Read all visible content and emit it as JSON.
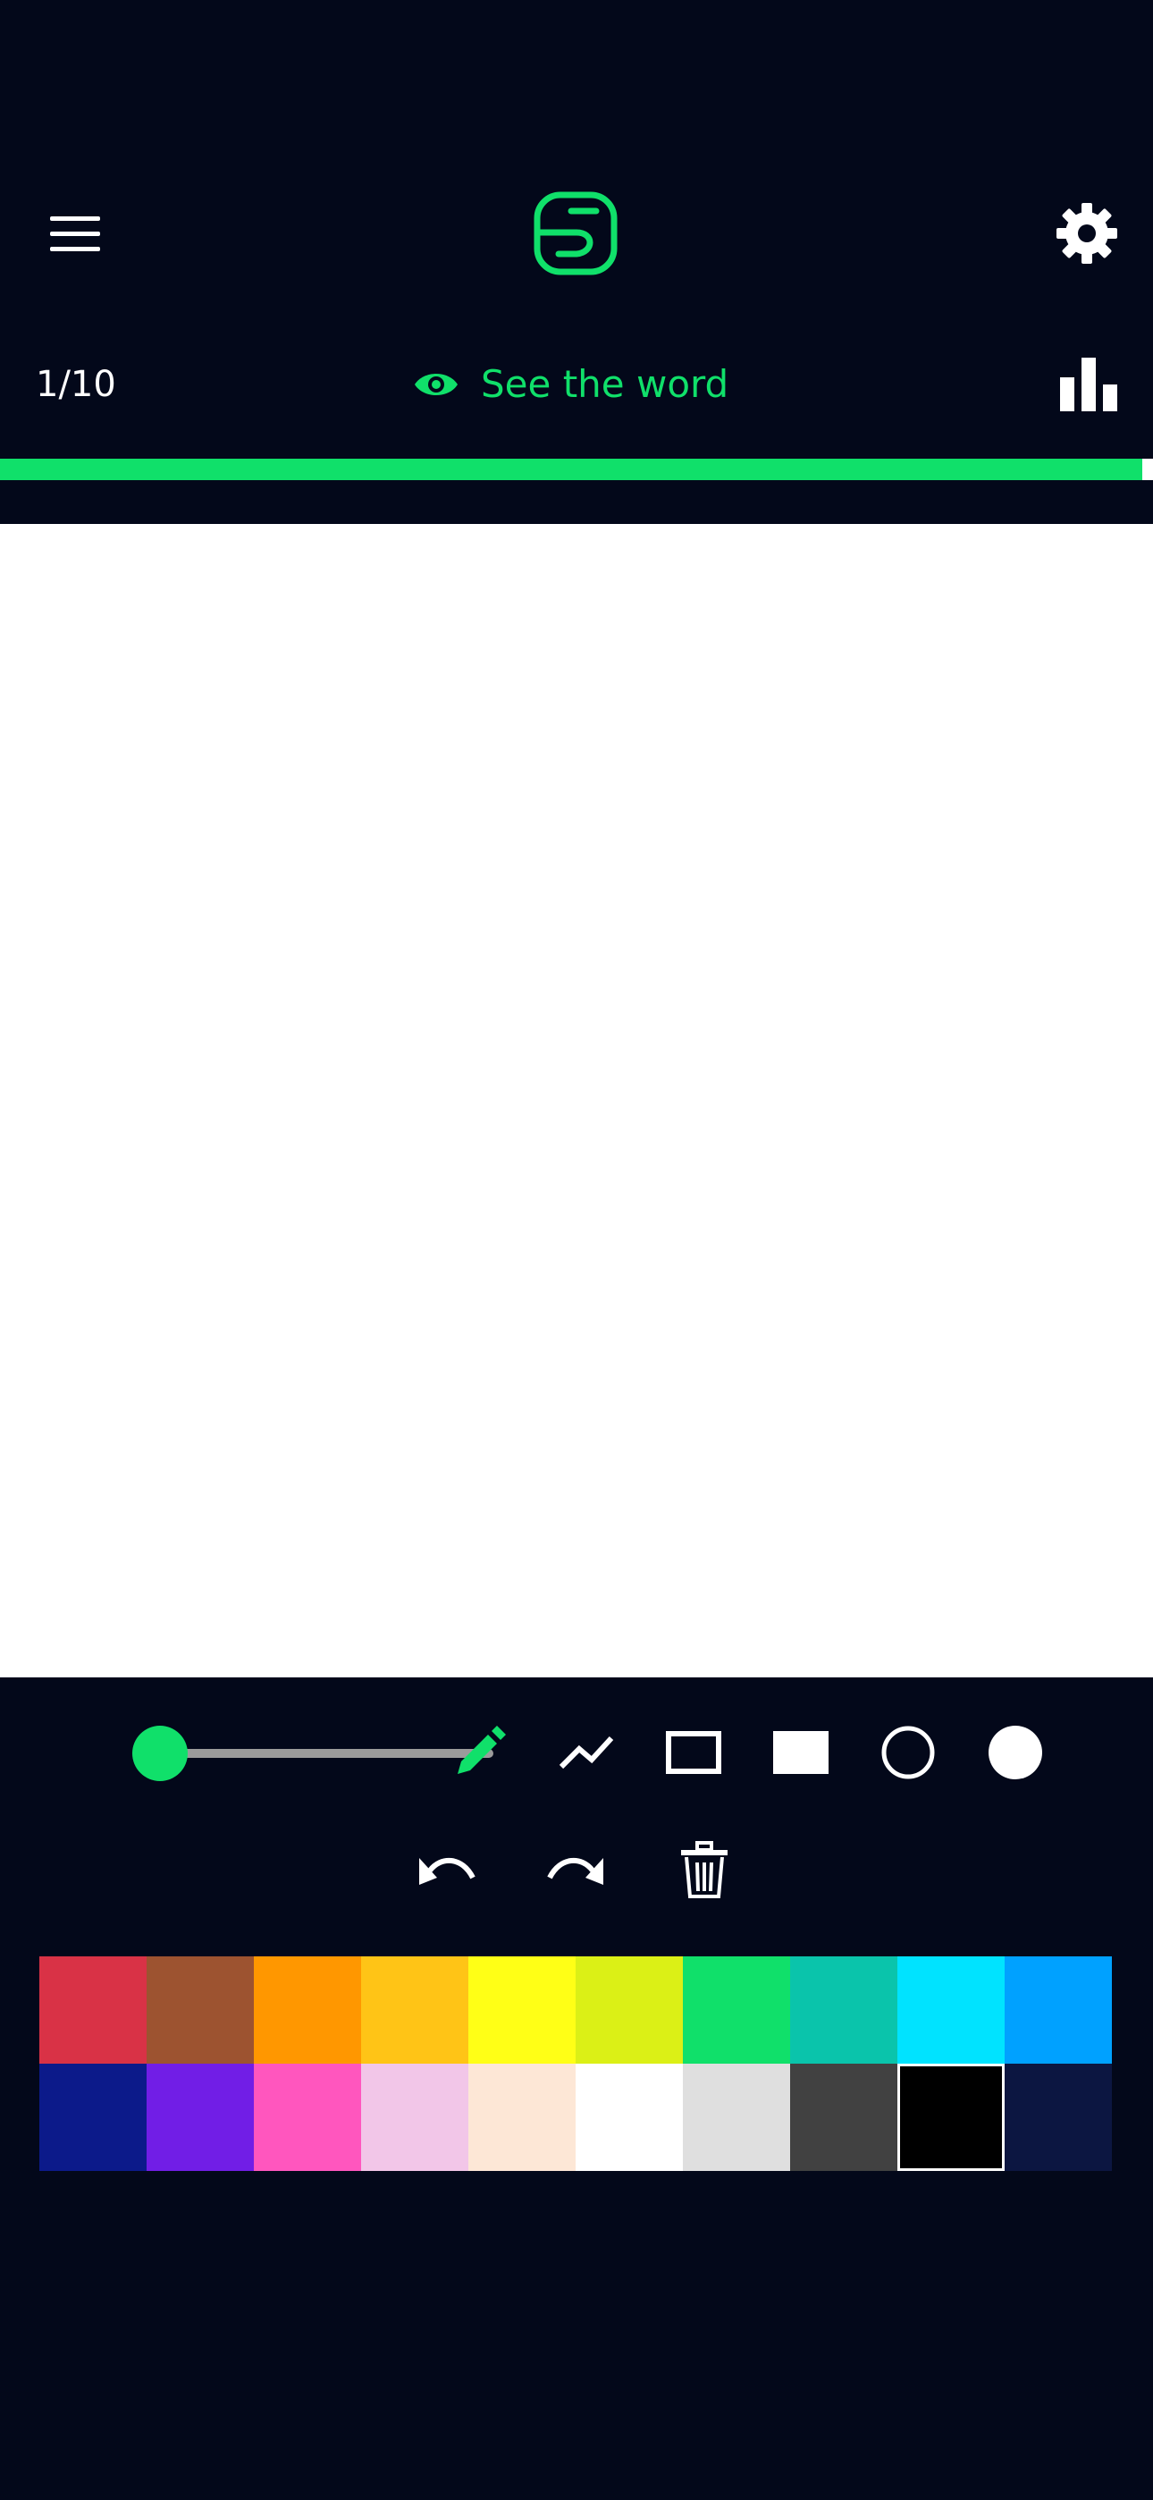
{
  "header": {
    "menu_icon": "hamburger-menu-icon",
    "logo_icon": "app-logo-icon",
    "settings_icon": "gear-icon",
    "accent_color": "#10e06a"
  },
  "status_bar": {
    "round_counter": "1/10",
    "see_word_label": "See the word",
    "see_word_icon": "eye-icon",
    "stats_icon": "bar-chart-icon"
  },
  "progress": {
    "fraction": 0.991
  },
  "toolbar": {
    "brush_size_fraction": 0.0,
    "tools": [
      {
        "name": "pencil",
        "icon": "pencil-icon",
        "active": true
      },
      {
        "name": "line",
        "icon": "line-icon",
        "active": false
      },
      {
        "name": "rectangle-outline",
        "icon": "rectangle-outline-icon",
        "active": false
      },
      {
        "name": "rectangle-filled",
        "icon": "rectangle-filled-icon",
        "active": false
      },
      {
        "name": "circle-outline",
        "icon": "circle-outline-icon",
        "active": false
      },
      {
        "name": "circle-filled",
        "icon": "circle-filled-icon",
        "active": false
      }
    ],
    "actions": [
      {
        "name": "undo",
        "icon": "undo-icon"
      },
      {
        "name": "redo",
        "icon": "redo-icon"
      },
      {
        "name": "clear",
        "icon": "trash-icon"
      }
    ]
  },
  "palette": {
    "selected_index": 18,
    "colors": [
      "#d93246",
      "#9d5330",
      "#ff9700",
      "#ffc416",
      "#ffff16",
      "#dbf016",
      "#10e06a",
      "#0ac4ab",
      "#00e3ff",
      "#00a1ff",
      "#0c1a8a",
      "#711ee6",
      "#ff56be",
      "#f2c6e8",
      "#fde7d6",
      "#ffffff",
      "#dfdfdf",
      "#414141",
      "#000000",
      "#0c1641"
    ]
  }
}
